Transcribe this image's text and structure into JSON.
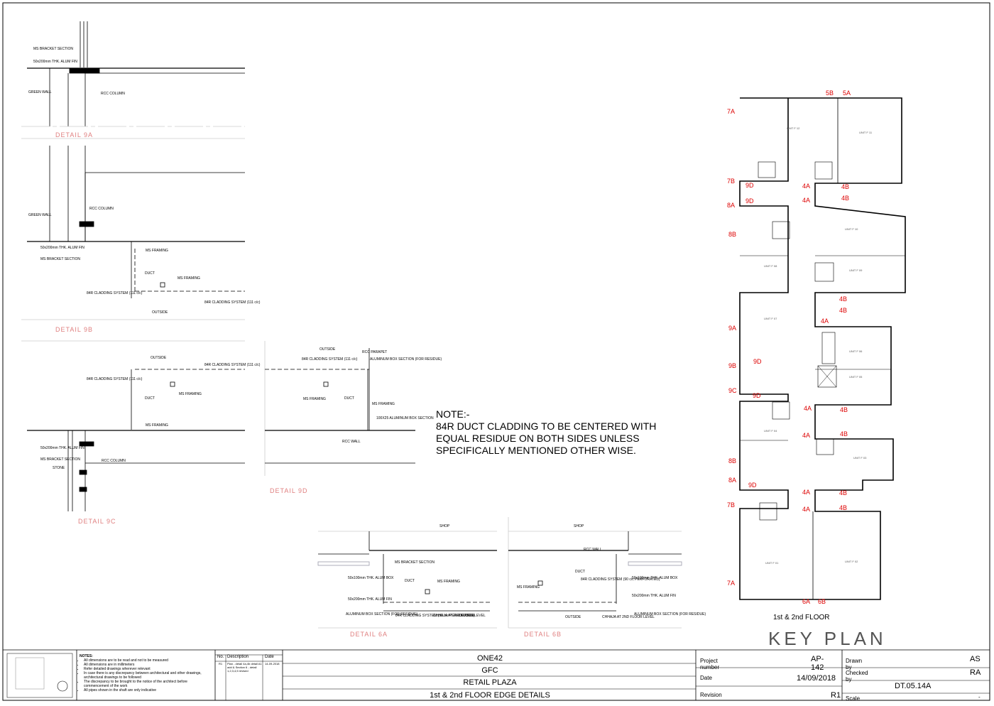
{
  "note": {
    "heading": "NOTE:-",
    "lines": [
      "84R DUCT CLADDING TO BE CENTERED WITH",
      "EQUAL RESIDUE ON BOTH SIDES UNLESS",
      "SPECIFICALLY MENTIONED OTHER WISE."
    ]
  },
  "details": {
    "d9a": "DETAIL 9A",
    "d9b": "DETAIL 9B",
    "d9c": "DETAIL 9C",
    "d9d": "DETAIL 9D",
    "d6a": "DETAIL 6A",
    "d6b": "DETAIL 6B"
  },
  "labels": {
    "ms_bracket": "MS BRACKET SECTION",
    "alum_fin": "50x200mm THK. ALUM FIN",
    "green_wall": "GREEN WALL",
    "rcc_column": "RCC COLUMN",
    "ms_framing": "MS FRAMING",
    "duct": "DUCT",
    "outside": "OUTSIDE",
    "cladding_111": "84R CLADDING SYSTEM (111 c/c)",
    "rcc_wall": "RCC WALL",
    "rcc_parapet": "RCC PARAPET",
    "alum_box": "ALUMINUM BOX SECTION (FOR RESIDUE)",
    "alum_section": "100X25 ALUMINUM BOX SECTION",
    "stone": "STONE",
    "shop": "SHOP",
    "chhaja": "CHHAJA AT 2ND FLOOR LEVEL",
    "cladding_90": "84R CLADDING SYSTEM (90 c/c PERFORATED)",
    "alum_box_100": "50x100mm THK. ALUM BOX"
  },
  "keyplan": {
    "title": "KEY PLAN",
    "floor": "1st & 2nd FLOOR",
    "units": [
      "UNIT F 12",
      "UNIT F 11",
      "UNIT F 10",
      "UNIT F 09",
      "UNIT F 08",
      "UNIT F 07",
      "UNIT F 06",
      "UNIT F 05",
      "UNIT F 04",
      "UNIT F 03",
      "UNIT F 02",
      "UNIT F 01"
    ]
  },
  "title_block": {
    "notes_heading": "NOTES:",
    "notes": [
      "All dimensions are to be read and not to be measured",
      "All dimensions are in millimeters",
      "Refer detailed drawings wherever relevant",
      "In case there is any discrepancy between architectural and other drawings, architectural drawings to be followed",
      "The discrepancy to be brought to the notice of the architect before commencement of the work",
      "All pipes shown in the shaft are only indicative"
    ],
    "rev_headers": [
      "No.",
      "Description",
      "Date"
    ],
    "rev_row": [
      "R1",
      "Plan - detail 4a,4b detail A1 add & Section 6 - detail 1,2,3,4,5 revised",
      "14-09-2018"
    ],
    "project_name": "ONE42",
    "issue": "GFC",
    "client": "RETAIL PLAZA",
    "sheet_title": "1st & 2nd FLOOR EDGE DETAILS",
    "project_number_label": "Project number",
    "project_number": "AP-142",
    "date_label": "Date",
    "date": "14/09/2018",
    "revision_label": "Revision",
    "revision": "R1",
    "drawn_by_label": "Drawn by",
    "drawn_by": "AS",
    "checked_by_label": "Checked by",
    "checked_by": "RA",
    "drawing_number": "DT.05.14A",
    "scale_label": "Scale",
    "scale": "-"
  }
}
